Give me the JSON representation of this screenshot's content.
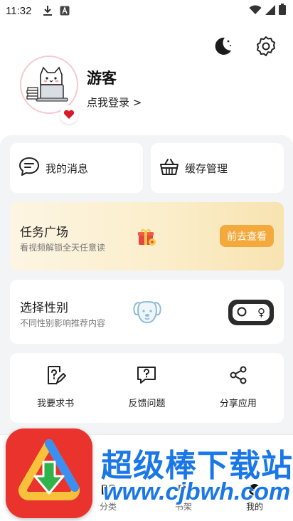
{
  "status_bar": {
    "time": "11:32",
    "icons": [
      "download-icon",
      "a-notification-icon",
      "wifi-icon",
      "signal-icon",
      "battery-icon"
    ]
  },
  "header": {
    "night_mode_icon": "moon-icon",
    "settings_icon": "gear-icon",
    "user_name": "游客",
    "login_link": "点我登录 >"
  },
  "quick_cards": {
    "messages_label": "我的消息",
    "cache_label": "缓存管理"
  },
  "task": {
    "title": "任务广场",
    "subtitle": "看视频解锁全天任意读",
    "button_label": "前去查看"
  },
  "gender": {
    "title": "选择性别",
    "subtitle": "不同性别影响推荐内容",
    "toggle_symbol": "♀"
  },
  "tools": [
    {
      "label": "我要求书",
      "icon": "request-book-icon"
    },
    {
      "label": "反馈问题",
      "icon": "feedback-icon"
    },
    {
      "label": "分享应用",
      "icon": "share-icon"
    }
  ],
  "bottom_nav": [
    {
      "label": "分类",
      "icon": "category-icon"
    },
    {
      "label": "书架",
      "icon": "bookshelf-icon"
    },
    {
      "label": "我的",
      "icon": "profile-icon"
    }
  ],
  "watermark": {
    "title": "超级棒下载站",
    "url": "www.cjbwh.com"
  },
  "colors": {
    "accent_orange": "#f4a93c",
    "panel_bg": "#f3f4f6",
    "watermark_blue": "#1a77e8",
    "watermark_red": "#e9332c"
  }
}
